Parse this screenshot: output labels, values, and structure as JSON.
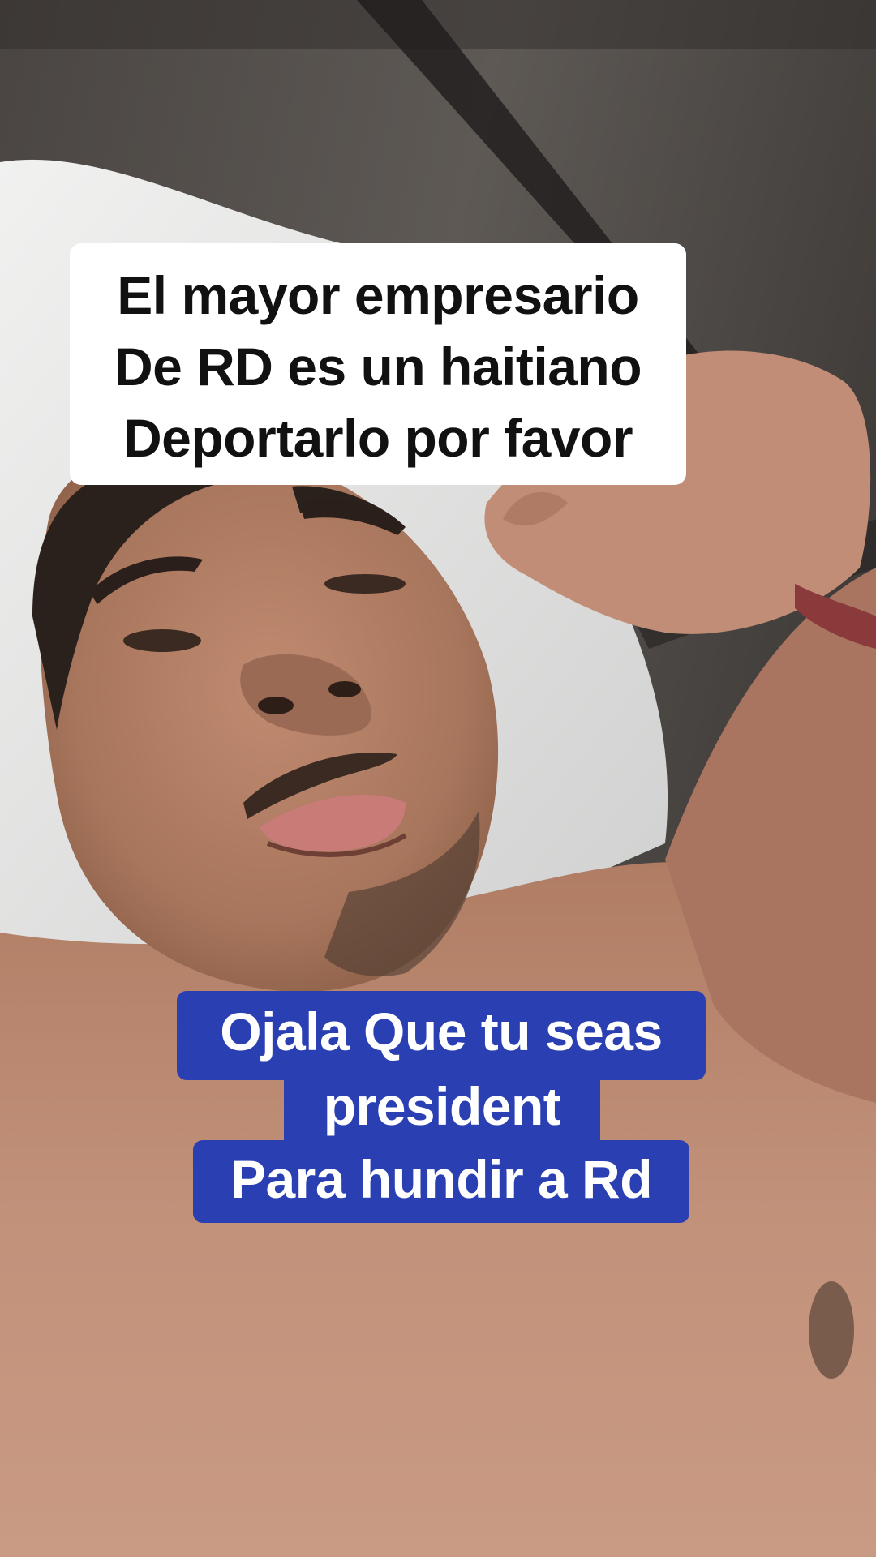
{
  "video": {
    "scene": "selfie-video-frame"
  },
  "captions": {
    "top": {
      "lines": [
        "El mayor empresario",
        "De RD es un haitiano",
        "Deportarlo por favor"
      ],
      "background": "#ffffff",
      "text_color": "#111111"
    },
    "bottom": {
      "lines": [
        "Ojala Que tu seas",
        "president",
        "Para hundir a Rd"
      ],
      "background": "#2a3fb2",
      "text_color": "#ffffff"
    }
  }
}
